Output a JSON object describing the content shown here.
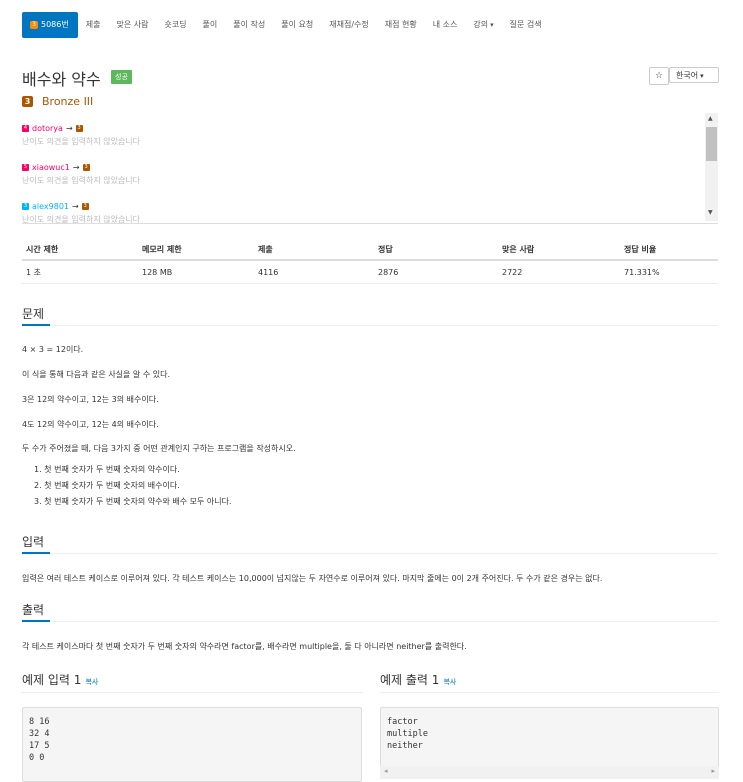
{
  "nav": {
    "problem_number": "5086번",
    "items": [
      "제출",
      "맞은 사람",
      "숏코딩",
      "풀이",
      "풀이 작성",
      "풀이 요청",
      "재채점/수정",
      "채점 현황",
      "내 소스",
      "강의",
      "질문 검색"
    ]
  },
  "title": "배수와 약수",
  "status_badge": "성공",
  "tier": {
    "icon_text": "3",
    "name": "Bronze III",
    "color": "#ad5600"
  },
  "star_label": "☆",
  "lang_label": "한국어",
  "opinions": [
    {
      "user": "dotorya",
      "tier_from_color": "#ff0062",
      "tier_to_color": "#ad5600",
      "note": "난이도 의견을 입력하지 않았습니다"
    },
    {
      "user": "xiaowuc1",
      "tier_from_color": "#ff0062",
      "tier_to_color": "#ad5600",
      "note": "난이도 의견을 입력하지 않았습니다"
    },
    {
      "user": "alex9801",
      "tier_from_color": "#00b4fc",
      "tier_to_color": "#ad5600",
      "note": "난이도 의견을 입력하지 않았습니다"
    }
  ],
  "info_table": {
    "headers": [
      "시간 제한",
      "메모리 제한",
      "제출",
      "정답",
      "맞은 사람",
      "정답 비율"
    ],
    "values": [
      "1 초",
      "128 MB",
      "4116",
      "2876",
      "2722",
      "71.331%"
    ]
  },
  "problem": {
    "heading": "문제",
    "lines": [
      "4 × 3 = 12이다.",
      "이 식을 통해 다음과 같은 사실을 알 수 있다.",
      "3은 12의 약수이고, 12는 3의 배수이다.",
      "4도 12의 약수이고, 12는 4의 배수이다.",
      "두 수가 주어졌을 때, 다음 3가지 중 어떤 관계인지 구하는 프로그램을 작성하시오."
    ],
    "list": [
      "1. 첫 번째 숫자가 두 번째 숫자의 약수이다.",
      "2. 첫 번째 숫자가 두 번째 숫자의 배수이다.",
      "3. 첫 번째 숫자가 두 번째 숫자의 약수와 배수 모두 아니다."
    ]
  },
  "input": {
    "heading": "입력",
    "text": "입력은 여러 테스트 케이스로 이루어져 있다. 각 테스트 케이스는 10,000이 넘지않는 두 자연수로 이루어져 있다. 마지막 줄에는 0이 2개 주어진다. 두 수가 같은 경우는 없다."
  },
  "output": {
    "heading": "출력",
    "text": "각 테스트 케이스마다 첫 번째 숫자가 두 번째 숫자의 약수라면 factor를, 배수라면 multiple을, 둘 다 아니라면 neither를 출력한다."
  },
  "sample_input": {
    "heading": "예제 입력 1",
    "copy": "복사",
    "content": "8 16\n32 4\n17 5\n0 0"
  },
  "sample_output": {
    "heading": "예제 출력 1",
    "copy": "복사",
    "content": "factor\nmultiple\nneither"
  }
}
